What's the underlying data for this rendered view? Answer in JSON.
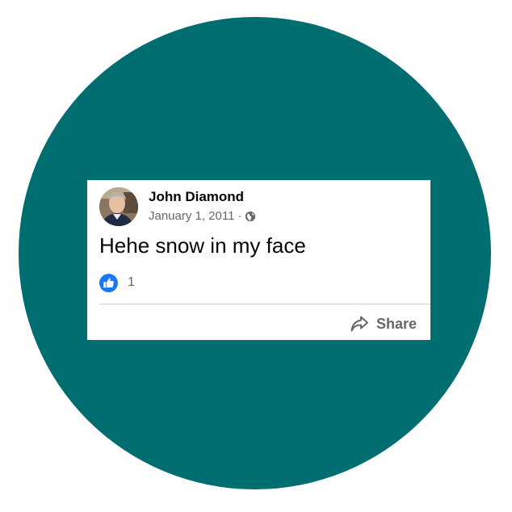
{
  "post": {
    "author": "John Diamond",
    "date": "January 1, 2011",
    "separator": "·",
    "audience_icon": "globe-icon",
    "text": "Hehe snow in my face",
    "reactions": {
      "icon": "like-icon",
      "count": "1"
    },
    "actions": {
      "share_label": "Share",
      "share_icon": "share-icon"
    }
  },
  "colors": {
    "background_circle": "#006d70",
    "card_background": "#ffffff",
    "primary_text": "#050505",
    "secondary_text": "#65676b",
    "like_blue": "#1877f2",
    "divider": "#ced0d4"
  }
}
